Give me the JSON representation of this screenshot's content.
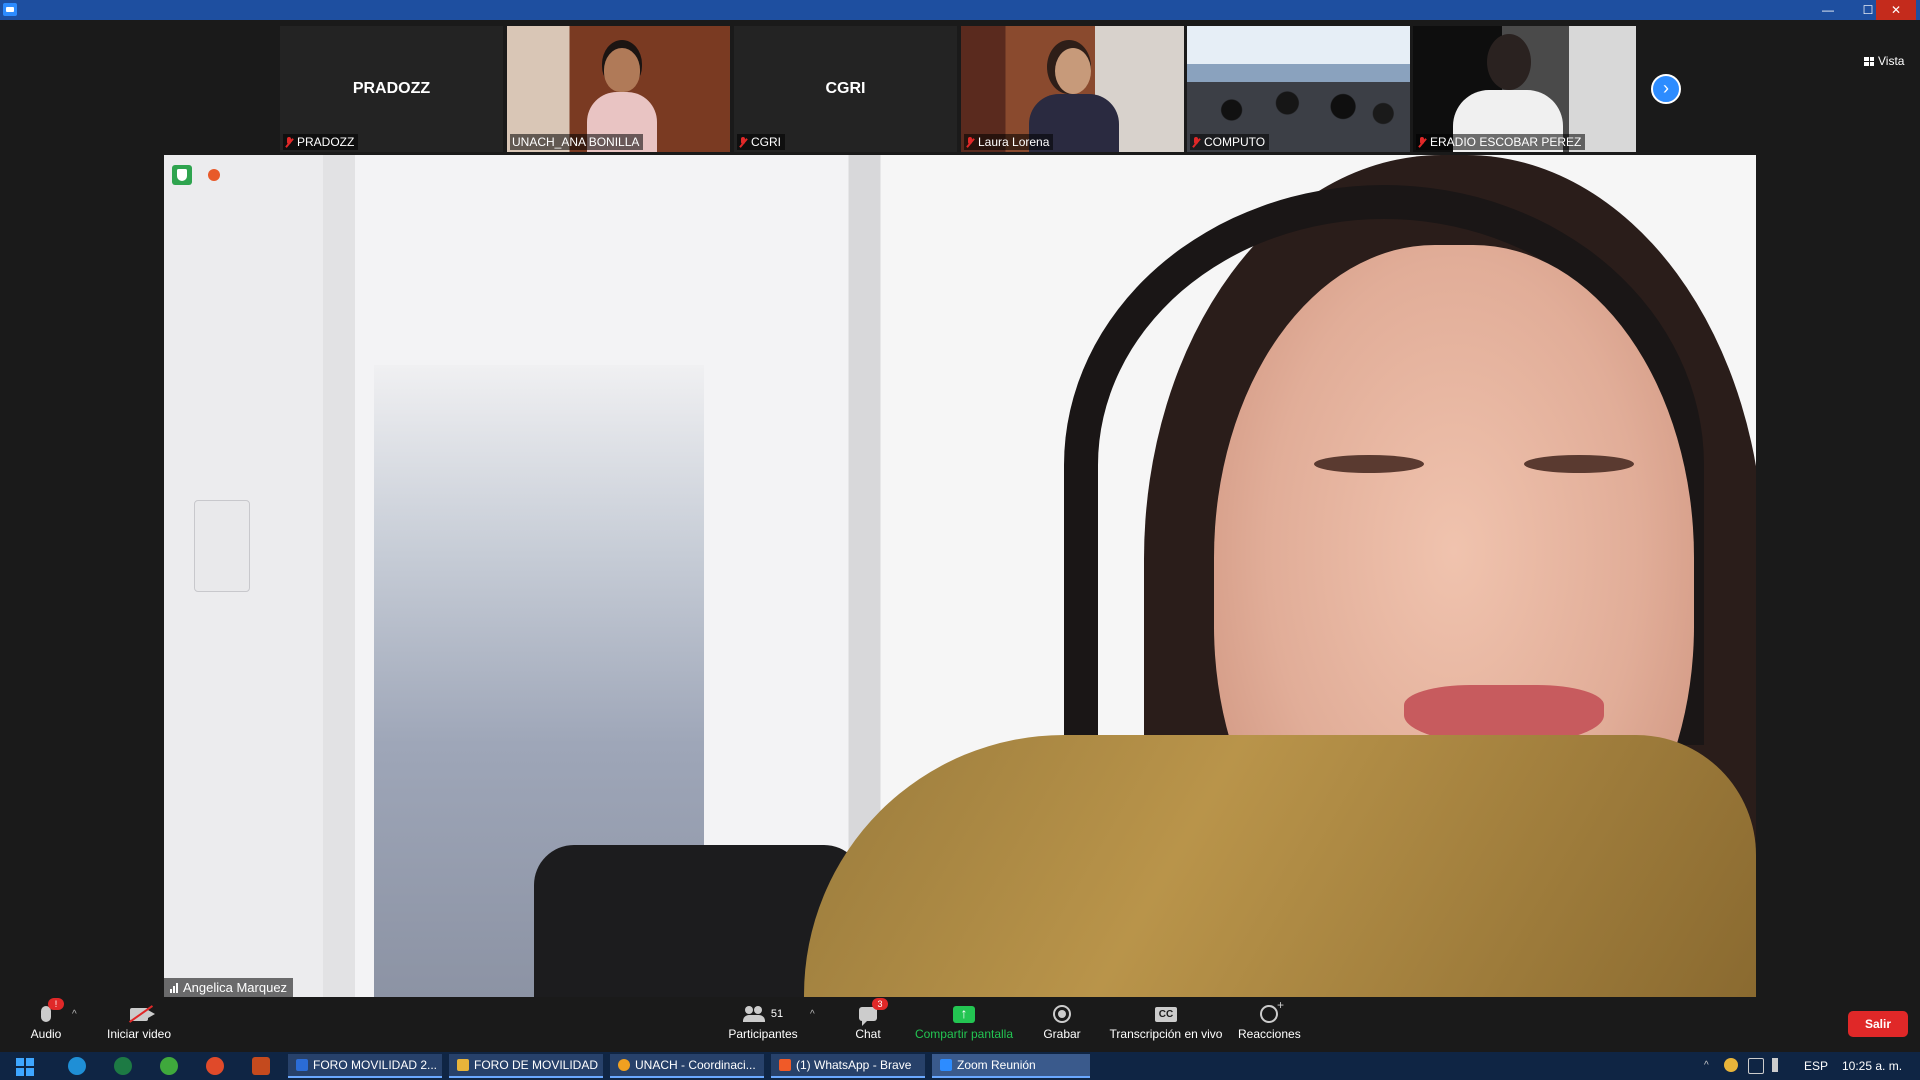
{
  "window": {
    "close_glyph": "✕",
    "min_glyph": "—",
    "max_glyph": "☐"
  },
  "participants_strip": {
    "tiles": [
      {
        "name": "PRADOZZ",
        "label": "PRADOZZ",
        "has_video": false
      },
      {
        "name": "UNACH_ANA BONILLA",
        "label": "UNACH_ANA BONILLA",
        "has_video": true
      },
      {
        "name": "CGRI",
        "label": "CGRI",
        "has_video": false
      },
      {
        "name": "Laura Lorena",
        "label": "Laura Lorena",
        "has_video": true
      },
      {
        "name": "COMPUTO",
        "label": "COMPUTO",
        "has_video": true
      },
      {
        "name": "ERADIO ESCOBAR PEREZ",
        "label": "ERADIO ESCOBAR PEREZ",
        "has_video": true
      }
    ],
    "next_glyph": "›",
    "view_label": "Vista"
  },
  "main_video": {
    "speaker_name": "Angelica Marquez"
  },
  "toolbar": {
    "audio_label": "Audio",
    "audio_badge": "!",
    "video_label": "Iniciar video",
    "participants_label": "Participantes",
    "participants_count": "51",
    "chat_label": "Chat",
    "chat_badge": "3",
    "share_label": "Compartir pantalla",
    "record_label": "Grabar",
    "transcription_label": "Transcripción en vivo",
    "cc_text": "CC",
    "reactions_label": "Reacciones",
    "leave_label": "Salir",
    "caret": "^"
  },
  "taskbar": {
    "tasks": [
      {
        "label": "FORO MOVILIDAD 2...",
        "icon_color": "#2b6cd6"
      },
      {
        "label": "FORO DE MOVILIDAD",
        "icon_color": "#e8b43a"
      },
      {
        "label": "UNACH - Coordinaci...",
        "icon_color": "#f0a020"
      },
      {
        "label": "(1) WhatsApp - Brave",
        "icon_color": "#f05a28"
      },
      {
        "label": "Zoom Reunión",
        "icon_color": "#2d8cff"
      }
    ],
    "language": "ESP",
    "time": "10:25 a. m.",
    "tray_caret": "^"
  },
  "colors": {
    "zoom_blue": "#2d8cff",
    "leave_red": "#e02828",
    "share_green": "#23c552",
    "taskbar_bg": "#0f2544"
  }
}
